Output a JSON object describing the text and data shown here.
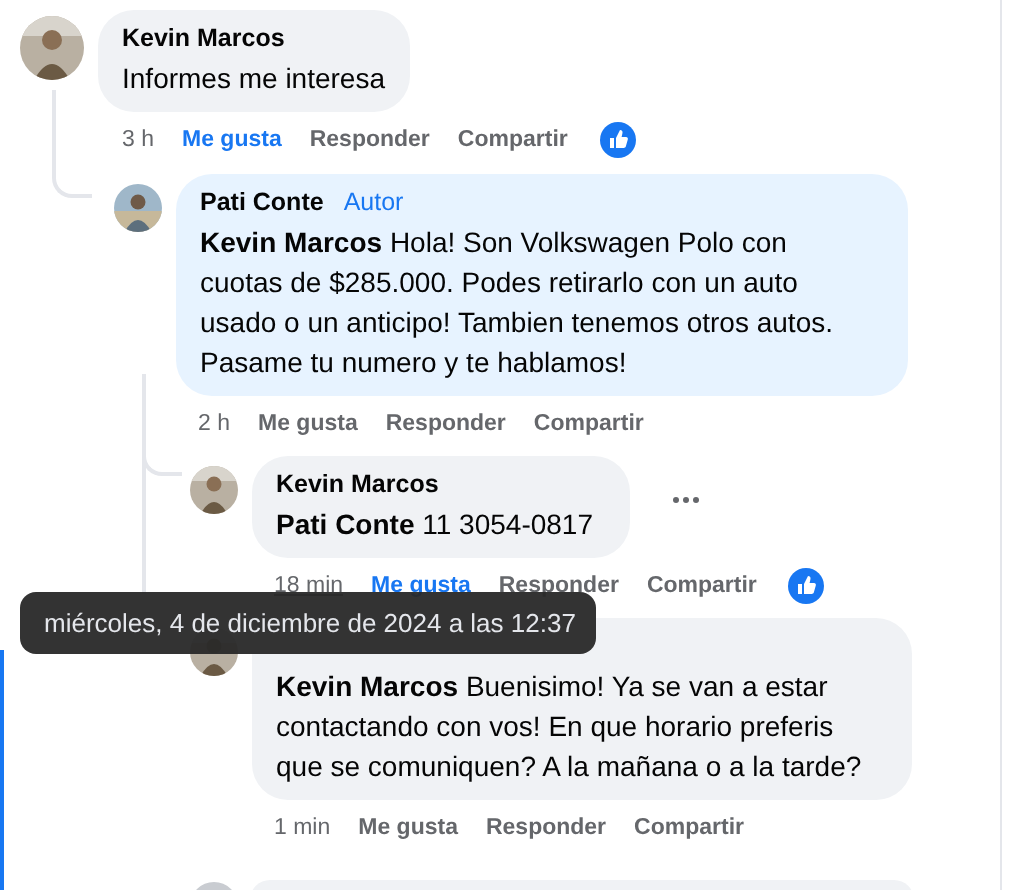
{
  "comments": [
    {
      "author": "Kevin Marcos",
      "text": "Informes me interesa",
      "time": "3 h",
      "like": "Me gusta",
      "liked": true,
      "reply": "Responder",
      "share": "Compartir",
      "reaction_shown": true,
      "children": [
        {
          "author": "Pati Conte",
          "badge": "Autor",
          "highlighted": true,
          "mention": "Kevin Marcos",
          "text": "Hola! Son Volkswagen Polo con cuotas de $285.000. Podes retirarlo con un auto usado o un anticipo! Tambien tenemos otros autos. Pasame tu numero y te hablamos!",
          "time": "2 h",
          "like": "Me gusta",
          "liked": false,
          "reply": "Responder",
          "share": "Compartir",
          "children": [
            {
              "author": "Kevin Marcos",
              "mention": "Pati Conte",
              "text": "11 3054-0817",
              "time": "18 min",
              "time_hovered": true,
              "like": "Me gusta",
              "liked": true,
              "reply": "Responder",
              "share": "Compartir",
              "reaction_shown": true,
              "menu_shown": true
            },
            {
              "mention": "Kevin Marcos",
              "text": "Buenisimo! Ya se van a estar contactando con vos! En que horario preferis que se comuniquen? A la mañana o a la tarde?",
              "time": "1 min",
              "like": "Me gusta",
              "liked": false,
              "reply": "Responder",
              "share": "Compartir"
            }
          ]
        }
      ]
    }
  ],
  "tooltip": {
    "text": "miércoles, 4 de diciembre de 2024 a las 12:37"
  }
}
